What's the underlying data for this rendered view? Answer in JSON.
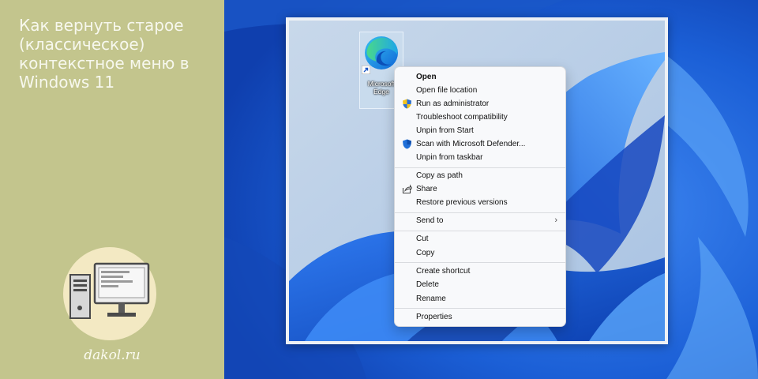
{
  "title": "Как вернуть старое\n(классическое)\nконтекстное меню в\nWindows 11",
  "site": "dakol.ru",
  "desktop_icon": {
    "label_line1": "Microsoft",
    "label_line2": "Edge",
    "icon": "edge-icon"
  },
  "menu": {
    "items": [
      {
        "label": "Open",
        "bold": true
      },
      {
        "label": "Open file location"
      },
      {
        "label": "Run as administrator",
        "icon": "uac-shield-icon"
      },
      {
        "label": "Troubleshoot compatibility"
      },
      {
        "label": "Unpin from Start"
      },
      {
        "label": "Scan with Microsoft Defender...",
        "icon": "defender-shield-icon"
      },
      {
        "label": "Unpin from taskbar"
      },
      {
        "label": "Copy as path"
      },
      {
        "label": "Share",
        "icon": "share-icon"
      },
      {
        "label": "Restore previous versions"
      },
      {
        "label": "Send to",
        "submenu": true
      },
      {
        "label": "Cut"
      },
      {
        "label": "Copy"
      },
      {
        "label": "Create shortcut"
      },
      {
        "label": "Delete"
      },
      {
        "label": "Rename"
      },
      {
        "label": "Properties"
      }
    ]
  },
  "colors": {
    "left_panel": "#c3c58d",
    "badge": "#f3e9c3",
    "wallpaper": "#1f62d8",
    "menu_bg": "#f8f9fb"
  }
}
